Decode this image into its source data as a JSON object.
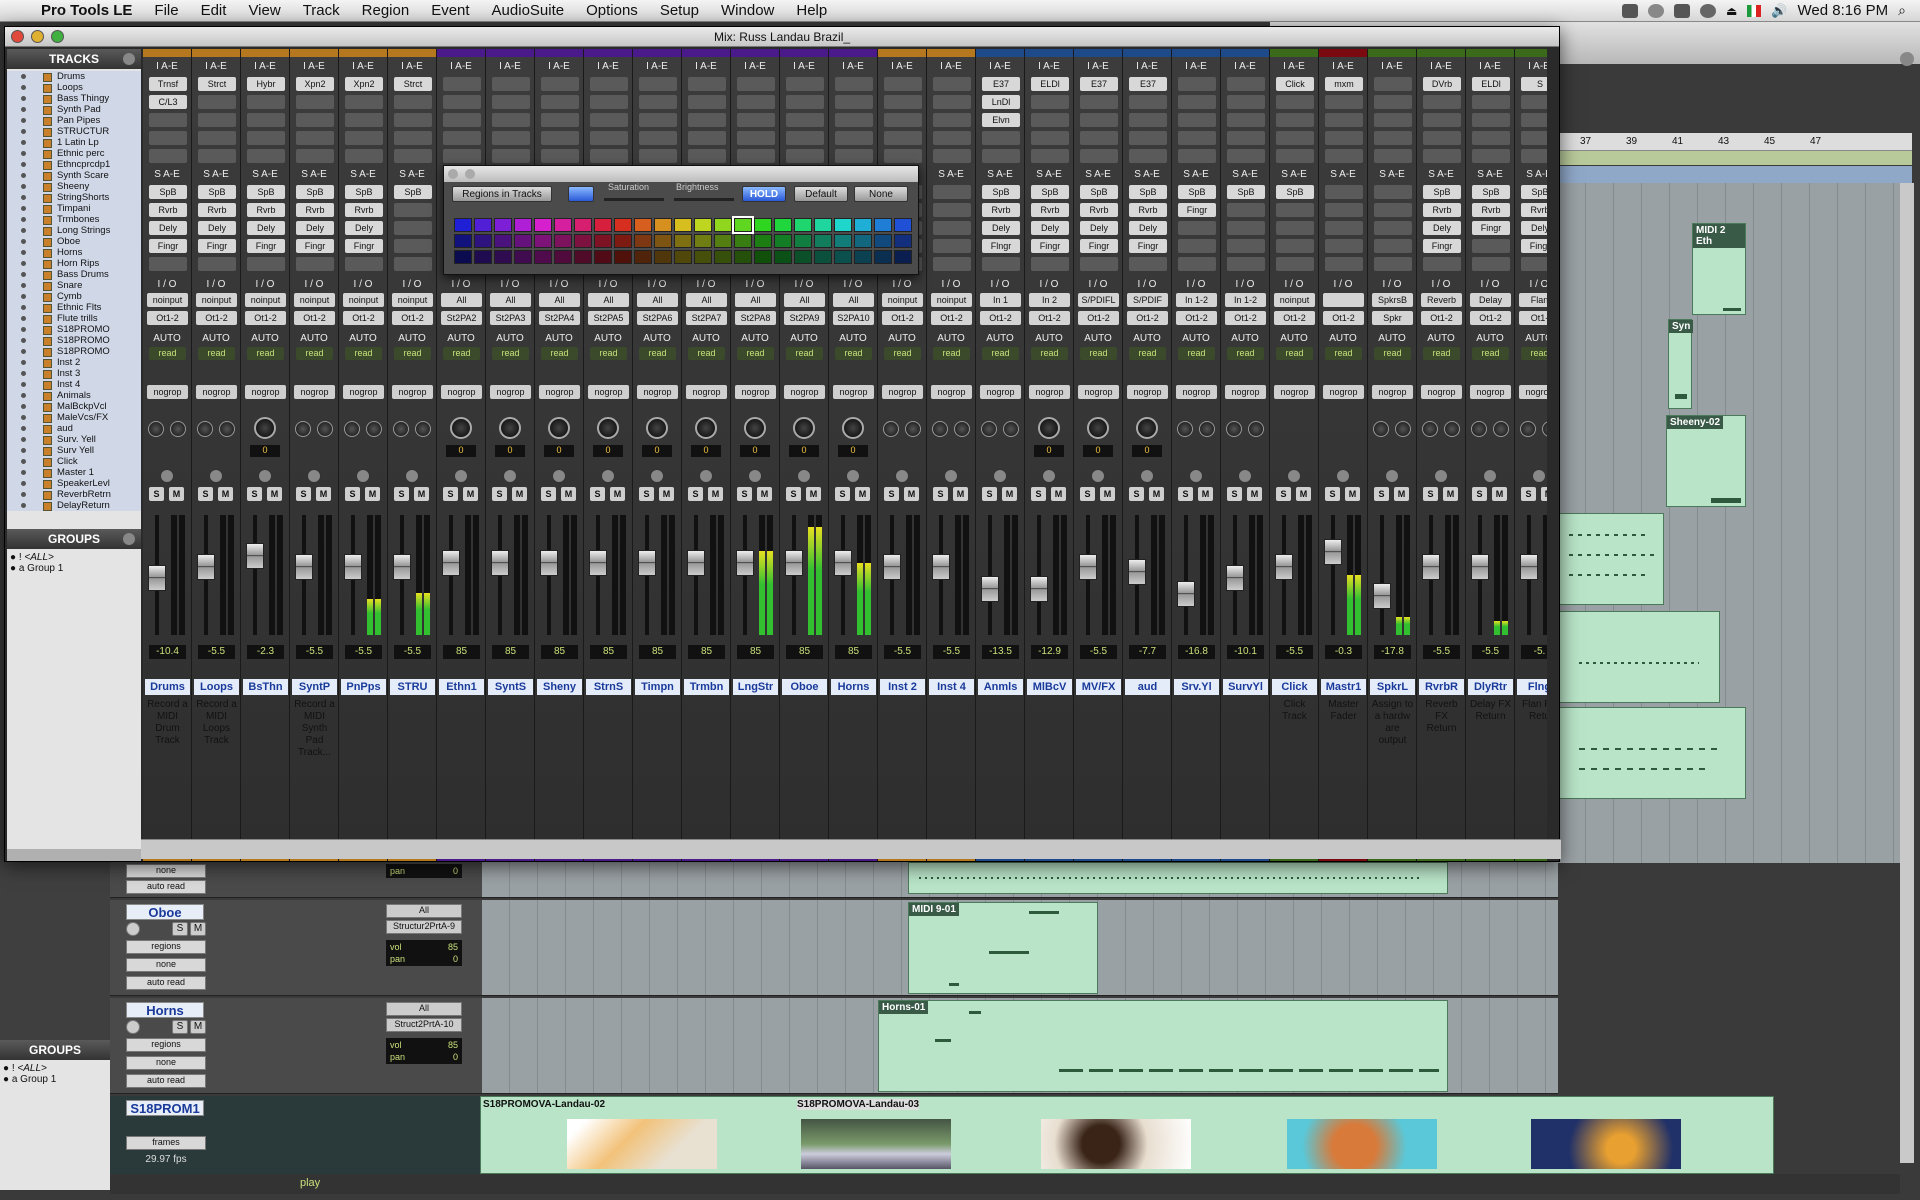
{
  "menubar": {
    "app_name": "Pro Tools LE",
    "items": [
      "File",
      "Edit",
      "View",
      "Track",
      "Region",
      "Event",
      "AudioSuite",
      "Options",
      "Setup",
      "Window",
      "Help"
    ],
    "clock": "Wed 8:16 PM"
  },
  "mix_window": {
    "title": "Mix: Russ Landau Brazil_",
    "tracks_header": "TRACKS",
    "groups_header": "GROUPS"
  },
  "track_list": [
    "Drums",
    "Loops",
    "Bass Thingy",
    "Synth Pad",
    "Pan Pipes",
    "STRUCTUR",
    "1 Latin Lp",
    "Ethnic perc",
    "Ethncprcdp1",
    "Synth Scare",
    "Sheeny",
    "StringShorts",
    "Timpani",
    "Trmbones",
    "Long Strings",
    "Oboe",
    "Horns",
    "Horn Rips",
    "Bass Drums",
    "Snare",
    "Cymb",
    "Ethnic Flts",
    "Flute trills",
    "S18PROMO",
    "S18PROMO",
    "S18PROMO",
    "Inst 2",
    "Inst 3",
    "Inst 4",
    "Animals",
    "MalBckpVcl",
    "MaleVcs/FX",
    "aud",
    "Surv. Yell",
    "Surv Yell",
    "Click",
    "Master 1",
    "SpeakerLevl",
    "ReverbRetrn",
    "DelayReturn"
  ],
  "groups": [
    {
      "tag": "!",
      "name": "<ALL>"
    },
    {
      "tag": "a",
      "name": "Group 1"
    }
  ],
  "strip_labels": {
    "inserts": "I A-E",
    "sends": "S A-E",
    "io": "I / O",
    "auto": "AUTO",
    "read": "read",
    "nogroup": "nogrop",
    "solo": "S",
    "mute": "M"
  },
  "strips": [
    {
      "name": "Drums",
      "color": "#b5781f",
      "ins": [
        "Trnsf",
        "C/L3"
      ],
      "sends": [
        "SpB",
        "Rvrb",
        "Dely",
        "Fingr"
      ],
      "in": "noinput",
      "out": "Ot1-2",
      "pan": "",
      "vol": "-10.4",
      "fader": 0.55,
      "meter": 0,
      "comment": "Record a MIDI Drum Track",
      "knob": "dual"
    },
    {
      "name": "Loops",
      "color": "#b5781f",
      "ins": [
        "Strct"
      ],
      "sends": [
        "SpB",
        "Rvrb",
        "Dely",
        "Fingr"
      ],
      "in": "noinput",
      "out": "Ot1-2",
      "pan": "",
      "vol": "-5.5",
      "fader": 0.65,
      "meter": 0,
      "comment": "Record a MIDI Loops Track",
      "knob": "dual"
    },
    {
      "name": "BsThn",
      "color": "#b5781f",
      "ins": [
        "Hybr"
      ],
      "sends": [
        "SpB",
        "Rvrb",
        "Dely",
        "Fingr"
      ],
      "in": "noinput",
      "out": "Ot1-2",
      "pan": "0",
      "vol": "-2.3",
      "fader": 0.75,
      "meter": 0,
      "comment": "",
      "knob": "big"
    },
    {
      "name": "SyntP",
      "color": "#b5781f",
      "ins": [
        "Xpn2"
      ],
      "sends": [
        "SpB",
        "Rvrb",
        "Dely",
        "Fingr"
      ],
      "in": "noinput",
      "out": "Ot1-2",
      "pan": "",
      "vol": "-5.5",
      "fader": 0.65,
      "meter": 0,
      "comment": "Record a MIDI Synth Pad Track...",
      "knob": "dual"
    },
    {
      "name": "PnPps",
      "color": "#b5781f",
      "ins": [
        "Xpn2"
      ],
      "sends": [
        "SpB",
        "Rvrb",
        "Dely",
        "Fingr"
      ],
      "in": "noinput",
      "out": "Ot1-2",
      "pan": "",
      "vol": "-5.5",
      "fader": 0.65,
      "meter": 0.3,
      "comment": "",
      "knob": "dual"
    },
    {
      "name": "STRU",
      "color": "#b5781f",
      "ins": [
        "Strct"
      ],
      "sends": [
        "SpB"
      ],
      "in": "noinput",
      "out": "Ot1-2",
      "pan": "",
      "vol": "-5.5",
      "fader": 0.65,
      "meter": 0.35,
      "comment": "",
      "knob": "dual"
    },
    {
      "name": "Ethn1",
      "color": "#4a1a8a",
      "ins": [],
      "sends": [],
      "in": "All",
      "out": "St2PA2",
      "pan": "0",
      "vol": "85",
      "fader": 0.68,
      "meter": 0,
      "comment": "",
      "knob": "big"
    },
    {
      "name": "SyntS",
      "color": "#4a1a8a",
      "ins": [],
      "sends": [],
      "in": "All",
      "out": "St2PA3",
      "pan": "0",
      "vol": "85",
      "fader": 0.68,
      "meter": 0,
      "comment": "",
      "knob": "big"
    },
    {
      "name": "Sheny",
      "color": "#4a1a8a",
      "ins": [],
      "sends": [],
      "in": "All",
      "out": "St2PA4",
      "pan": "0",
      "vol": "85",
      "fader": 0.68,
      "meter": 0,
      "comment": "",
      "knob": "big"
    },
    {
      "name": "StrnS",
      "color": "#4a1a8a",
      "ins": [],
      "sends": [],
      "in": "All",
      "out": "St2PA5",
      "pan": "0",
      "vol": "85",
      "fader": 0.68,
      "meter": 0,
      "comment": "",
      "knob": "big"
    },
    {
      "name": "Timpn",
      "color": "#4a1a8a",
      "ins": [],
      "sends": [],
      "in": "All",
      "out": "St2PA6",
      "pan": "0",
      "vol": "85",
      "fader": 0.68,
      "meter": 0,
      "comment": "",
      "knob": "big"
    },
    {
      "name": "Trmbn",
      "color": "#4a1a8a",
      "ins": [],
      "sends": [],
      "in": "All",
      "out": "St2PA7",
      "pan": "0",
      "vol": "85",
      "fader": 0.68,
      "meter": 0,
      "comment": "",
      "knob": "big"
    },
    {
      "name": "LngStr",
      "color": "#4a1a8a",
      "ins": [],
      "sends": [],
      "in": "All",
      "out": "St2PA8",
      "pan": "0",
      "vol": "85",
      "fader": 0.68,
      "meter": 0.7,
      "comment": "",
      "knob": "big"
    },
    {
      "name": "Oboe",
      "color": "#4a1a8a",
      "ins": [],
      "sends": [],
      "in": "All",
      "out": "St2PA9",
      "pan": "0",
      "vol": "85",
      "fader": 0.68,
      "meter": 0.9,
      "comment": "",
      "knob": "big"
    },
    {
      "name": "Horns",
      "color": "#4a1a8a",
      "ins": [],
      "sends": [],
      "in": "All",
      "out": "S2PA10",
      "pan": "0",
      "vol": "85",
      "fader": 0.68,
      "meter": 0.6,
      "comment": "",
      "knob": "big"
    },
    {
      "name": "Inst 2",
      "color": "#b5781f",
      "ins": [],
      "sends": [],
      "in": "noinput",
      "out": "Ot1-2",
      "pan": "",
      "vol": "-5.5",
      "fader": 0.65,
      "meter": 0,
      "comment": "",
      "knob": "dual"
    },
    {
      "name": "Inst 4",
      "color": "#b5781f",
      "ins": [],
      "sends": [],
      "in": "noinput",
      "out": "Ot1-2",
      "pan": "",
      "vol": "-5.5",
      "fader": 0.65,
      "meter": 0,
      "comment": "",
      "knob": "dual"
    },
    {
      "name": "Anmls",
      "color": "#1e4a8a",
      "ins": [
        "E37",
        "LnDl",
        "Elvn"
      ],
      "sends": [
        "SpB",
        "Rvrb",
        "Dely",
        "Flngr"
      ],
      "in": "In 1",
      "out": "Ot1-2",
      "pan": "",
      "vol": "-13.5",
      "fader": 0.45,
      "meter": 0,
      "comment": "",
      "knob": "dual"
    },
    {
      "name": "MlBcV",
      "color": "#1e4a8a",
      "ins": [
        "ELDl"
      ],
      "sends": [
        "SpB",
        "Rvrb",
        "Dely",
        "Fingr"
      ],
      "in": "In 2",
      "out": "Ot1-2",
      "pan": "0",
      "vol": "-12.9",
      "fader": 0.45,
      "meter": 0,
      "comment": "",
      "knob": "big"
    },
    {
      "name": "MV/FX",
      "color": "#1e4a8a",
      "ins": [
        "E37"
      ],
      "sends": [
        "SpB",
        "Rvrb",
        "Dely",
        "Fingr"
      ],
      "in": "S/PDIFL",
      "out": "Ot1-2",
      "pan": "0",
      "vol": "-5.5",
      "fader": 0.65,
      "meter": 0,
      "comment": "",
      "knob": "big"
    },
    {
      "name": "aud",
      "color": "#1e4a8a",
      "ins": [
        "E37"
      ],
      "sends": [
        "SpB",
        "Rvrb",
        "Dely",
        "Fingr"
      ],
      "in": "S/PDIF",
      "out": "Ot1-2",
      "pan": "0",
      "vol": "-7.7",
      "fader": 0.6,
      "meter": 0,
      "comment": "",
      "knob": "big"
    },
    {
      "name": "Srv.Yl",
      "color": "#1e4a8a",
      "ins": [],
      "sends": [
        "SpB",
        "Fingr"
      ],
      "in": "In 1-2",
      "out": "Ot1-2",
      "pan": "",
      "vol": "-16.8",
      "fader": 0.4,
      "meter": 0,
      "comment": "",
      "knob": "dual"
    },
    {
      "name": "SurvYl",
      "color": "#1e4a8a",
      "ins": [],
      "sends": [
        "SpB"
      ],
      "in": "In 1-2",
      "out": "Ot1-2",
      "pan": "",
      "vol": "-10.1",
      "fader": 0.55,
      "meter": 0,
      "comment": "",
      "knob": "dual"
    },
    {
      "name": "Click",
      "color": "#3a6a1a",
      "ins": [
        "Click"
      ],
      "sends": [
        "SpB"
      ],
      "in": "noinput",
      "out": "Ot1-2",
      "pan": "",
      "vol": "-5.5",
      "fader": 0.65,
      "meter": 0,
      "comment": "Click Track",
      "knob": "none"
    },
    {
      "name": "Mastr1",
      "color": "#7a0a10",
      "ins": [
        "mxm"
      ],
      "sends": [],
      "in": "",
      "out": "Ot1-2",
      "pan": "",
      "vol": "-0.3",
      "fader": 0.78,
      "meter": 0.5,
      "comment": "Master Fader",
      "knob": "none"
    },
    {
      "name": "SpkrL",
      "color": "#3a6a1a",
      "ins": [],
      "sends": [],
      "in": "SpkrsB",
      "out": "Spkr",
      "pan": "",
      "vol": "-17.8",
      "fader": 0.38,
      "meter": 0.15,
      "comment": "Assign to a hardw are output",
      "knob": "dual"
    },
    {
      "name": "RvrbR",
      "color": "#3a6a1a",
      "ins": [
        "DVrb"
      ],
      "sends": [
        "SpB",
        "Rvrb",
        "Dely",
        "Fingr"
      ],
      "in": "Reverb",
      "out": "Ot1-2",
      "pan": "",
      "vol": "-5.5",
      "fader": 0.65,
      "meter": 0,
      "comment": "Reverb FX Return",
      "knob": "dual"
    },
    {
      "name": "DlyRtr",
      "color": "#3a6a1a",
      "ins": [
        "ELDl"
      ],
      "sends": [
        "SpB",
        "Rvrb",
        "Fingr"
      ],
      "in": "Delay",
      "out": "Ot1-2",
      "pan": "",
      "vol": "-5.5",
      "fader": 0.65,
      "meter": 0.12,
      "comment": "Delay FX Return",
      "knob": "dual"
    },
    {
      "name": "Flng",
      "color": "#3a6a1a",
      "ins": [
        "S"
      ],
      "sends": [
        "SpB",
        "Rvrb",
        "Dely",
        "Fingr"
      ],
      "in": "Flan",
      "out": "Ot1-",
      "pan": "",
      "vol": "-5.",
      "fader": 0.65,
      "meter": 0,
      "comment": "Flan FX Retu",
      "knob": "dual"
    }
  ],
  "palette": {
    "mode": "Regions in Tracks",
    "saturation_label": "Saturation",
    "brightness_label": "Brightness",
    "hold": "HOLD",
    "default": "Default",
    "none": "None"
  },
  "ruler": [
    "37",
    "39",
    "41",
    "43",
    "45",
    "47"
  ],
  "regions": {
    "r1": "MIDI 2 Eth",
    "r2": "Syn",
    "r3": "Sheeny-02",
    "r4": "MIDI 9-01",
    "r5": "Horns-01",
    "v1": "S18PROMOVA-Landau-02",
    "v2": "S18PROMOVA-Landau-03"
  },
  "lower_tracks": {
    "oboe": {
      "name": "Oboe",
      "view": "regions",
      "none": "none",
      "auto": "auto read",
      "input": "All",
      "output": "Structur2PrtA-9",
      "vol_label": "vol",
      "vol": "85",
      "pan_label": "pan",
      "pan": "0"
    },
    "horns": {
      "name": "Horns",
      "view": "regions",
      "none": "none",
      "auto": "auto read",
      "input": "All",
      "output": "Struct2PrtA-10",
      "vol_label": "vol",
      "vol": "85",
      "pan_label": "pan",
      "pan": "0"
    },
    "video": {
      "name": "S18PROM1",
      "view": "frames",
      "fps": "29.97 fps"
    },
    "top": {
      "none": "none",
      "auto": "auto read",
      "pan_label": "pan",
      "pan": "0"
    }
  },
  "bottom_bar": {
    "status": "play"
  },
  "colors": {
    "purple": "#4a1a8a",
    "orange": "#b5781f",
    "blue": "#1e4a8a",
    "green": "#3a6a1a",
    "red": "#7a0a10"
  }
}
